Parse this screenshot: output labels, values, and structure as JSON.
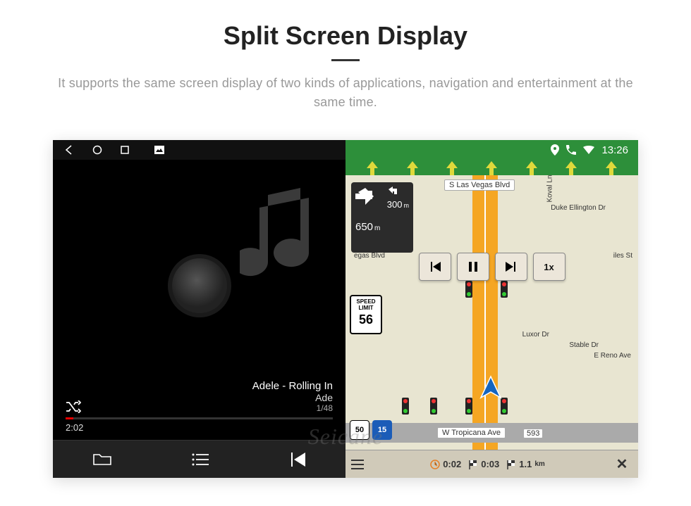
{
  "header": {
    "title": "Split Screen Display",
    "subtitle": "It supports the same screen display of two kinds of applications, navigation and entertainment at the same time."
  },
  "statusbar": {
    "time": "13:26"
  },
  "music": {
    "track_title": "Adele - Rolling In",
    "artist": "Ade",
    "track_count": "1/48",
    "elapsed": "2:02"
  },
  "nav": {
    "turn": {
      "next_distance_value": "300",
      "next_distance_unit": "m",
      "main_distance_value": "650",
      "main_distance_unit": "m"
    },
    "speed_limit": {
      "label": "SPEED LIMIT",
      "value": "56"
    },
    "shields": {
      "route_a": "50",
      "route_b": "15"
    },
    "playback_speed": "1x",
    "streets": {
      "top": "S Las Vegas Blvd",
      "bottom": "W Tropicana Ave",
      "bottom_num": "593",
      "duke": "Duke Ellington Dr",
      "koval": "Koval Ln",
      "luxor": "Luxor Dr",
      "stable": "Stable Dr",
      "reno": "E Reno Ave",
      "giles": "iles St",
      "vegas": "egas Blvd"
    },
    "bottom": {
      "time_a": "0:02",
      "time_b": "0:03",
      "dist_value": "1.1",
      "dist_unit": "km"
    }
  },
  "watermark": "Seicane"
}
